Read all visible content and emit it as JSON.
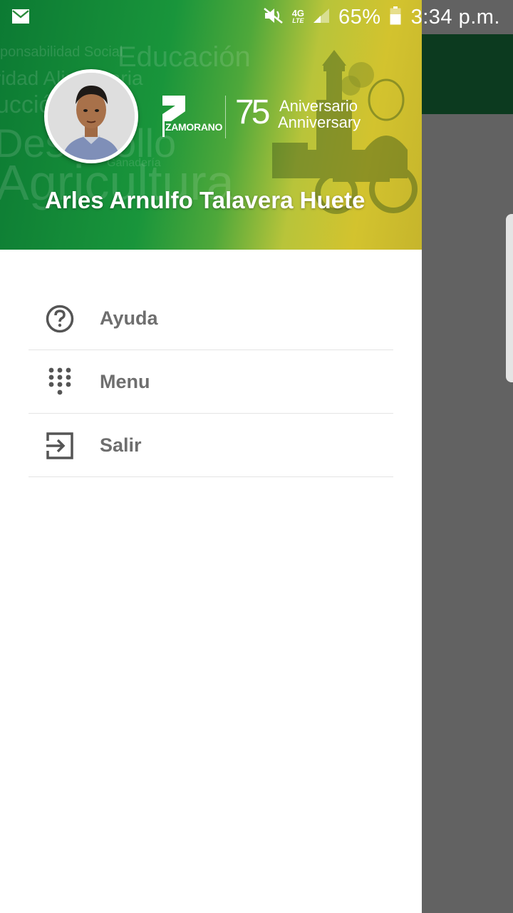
{
  "status_bar": {
    "battery_percent": "65%",
    "time": "3:34 p.m.",
    "network": "4G",
    "network_sub": "LTE",
    "icons": [
      "email-icon",
      "mute-icon",
      "signal-icon",
      "battery-icon"
    ]
  },
  "drawer": {
    "header": {
      "user_name": "Arles Arnulfo Talavera Huete",
      "logo_text": "ZAMORANO",
      "anniversary_number": "75",
      "anniversary_es": "Aniversario",
      "anniversary_en": "Anniversary",
      "watermark": {
        "w1": "ponsabilidad Social",
        "w2": "Educación",
        "w3": "ridad Alimentaria",
        "w4": "ucción",
        "w5": "Desarrollo",
        "w6": "Agricultura",
        "w7": "Ganadería"
      }
    },
    "menu": [
      {
        "label": "Ayuda",
        "icon": "help-icon"
      },
      {
        "label": "Menu",
        "icon": "dialpad-icon"
      },
      {
        "label": "Salir",
        "icon": "exit-icon"
      }
    ]
  },
  "colors": {
    "header_green": "#19953b",
    "header_yellow": "#d3c32e",
    "app_bar_dark_green": "#0c3a1f",
    "scrim_gray": "#626262",
    "menu_text": "#6e6e6e"
  }
}
